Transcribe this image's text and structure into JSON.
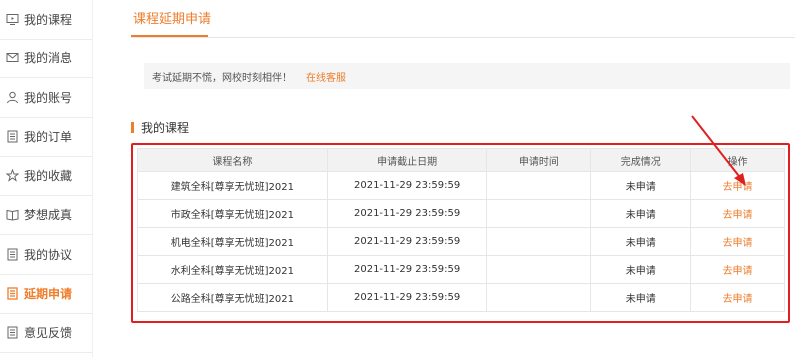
{
  "sidebar": {
    "items": [
      {
        "label": "我的课程",
        "icon": "monitor-icon"
      },
      {
        "label": "我的消息",
        "icon": "envelope-icon"
      },
      {
        "label": "我的账号",
        "icon": "user-icon"
      },
      {
        "label": "我的订单",
        "icon": "document-icon"
      },
      {
        "label": "我的收藏",
        "icon": "star-icon"
      },
      {
        "label": "梦想成真",
        "icon": "book-icon"
      },
      {
        "label": "我的协议",
        "icon": "document-icon"
      },
      {
        "label": "延期申请",
        "icon": "document-icon",
        "active": true
      },
      {
        "label": "意见反馈",
        "icon": "document-icon"
      }
    ]
  },
  "header": {
    "tab_label": "课程延期申请"
  },
  "notice": {
    "text": "考试延期不慌，网校时刻相伴！",
    "link": "在线客服"
  },
  "section": {
    "title": "我的课程"
  },
  "table": {
    "headers": [
      "课程名称",
      "申请截止日期",
      "申请时间",
      "完成情况",
      "操作"
    ],
    "rows": [
      {
        "name": "建筑全科[尊享无忧班]2021",
        "deadline": "2021-11-29 23:59:59",
        "time": "",
        "status": "未申请",
        "action": "去申请"
      },
      {
        "name": "市政全科[尊享无忧班]2021",
        "deadline": "2021-11-29 23:59:59",
        "time": "",
        "status": "未申请",
        "action": "去申请"
      },
      {
        "name": "机电全科[尊享无忧班]2021",
        "deadline": "2021-11-29 23:59:59",
        "time": "",
        "status": "未申请",
        "action": "去申请"
      },
      {
        "name": "水利全科[尊享无忧班]2021",
        "deadline": "2021-11-29 23:59:59",
        "time": "",
        "status": "未申请",
        "action": "去申请"
      },
      {
        "name": "公路全科[尊享无忧班]2021",
        "deadline": "2021-11-29 23:59:59",
        "time": "",
        "status": "未申请",
        "action": "去申请"
      }
    ]
  },
  "colors": {
    "accent": "#ee7d2c",
    "highlight_border": "#e02020"
  }
}
